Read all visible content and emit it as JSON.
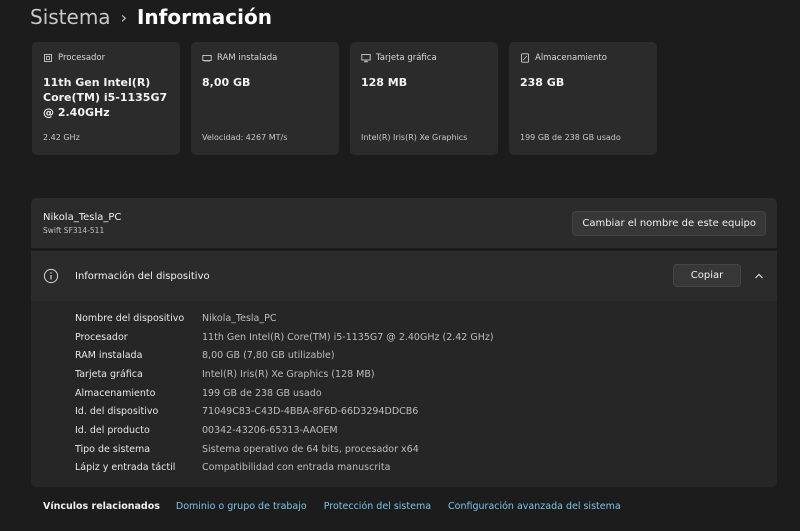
{
  "breadcrumb": {
    "parent": "Sistema",
    "separator": "›",
    "current": "Información"
  },
  "cards": [
    {
      "label": "Procesador",
      "value": "11th Gen Intel(R) Core(TM) i5-1135G7 @ 2.40GHz",
      "sub": "2.42 GHz",
      "icon": "processor-icon"
    },
    {
      "label": "RAM instalada",
      "value": "8,00 GB",
      "sub": "Velocidad: 4267 MT/s",
      "icon": "ram-icon"
    },
    {
      "label": "Tarjeta gráfica",
      "value": "128 MB",
      "sub": "Intel(R) Iris(R) Xe Graphics",
      "icon": "gpu-icon"
    },
    {
      "label": "Almacenamiento",
      "value": "238 GB",
      "sub": "199 GB de 238 GB usado",
      "icon": "storage-icon"
    }
  ],
  "device_name": {
    "name": "Nikola_Tesla_PC",
    "model": "Swift SF314-511",
    "rename_button": "Cambiar el nombre de este equipo"
  },
  "device_info": {
    "title": "Información del dispositivo",
    "copy_button": "Copiar",
    "rows": [
      {
        "label": "Nombre del dispositivo",
        "value": "Nikola_Tesla_PC"
      },
      {
        "label": "Procesador",
        "value": "11th Gen Intel(R) Core(TM) i5-1135G7 @ 2.40GHz (2.42 GHz)"
      },
      {
        "label": "RAM instalada",
        "value": "8,00 GB (7,80 GB utilizable)"
      },
      {
        "label": "Tarjeta gráfica",
        "value": "Intel(R) Iris(R) Xe Graphics (128 MB)"
      },
      {
        "label": "Almacenamiento",
        "value": "199 GB de 238 GB usado"
      },
      {
        "label": "Id. del dispositivo",
        "value": "71049C83-C43D-4BBA-8F6D-66D3294DDCB6"
      },
      {
        "label": "Id. del producto",
        "value": "00342-43206-65313-AAOEM"
      },
      {
        "label": "Tipo de sistema",
        "value": "Sistema operativo de 64 bits, procesador x64"
      },
      {
        "label": "Lápiz y entrada táctil",
        "value": "Compatibilidad con entrada manuscrita"
      }
    ]
  },
  "related": {
    "title": "Vínculos relacionados",
    "links": [
      "Dominio o grupo de trabajo",
      "Protección del sistema",
      "Configuración avanzada del sistema"
    ]
  },
  "colors": {
    "background": "#1c1c1c",
    "card": "#2b2b2b",
    "link": "#79c6e8"
  }
}
